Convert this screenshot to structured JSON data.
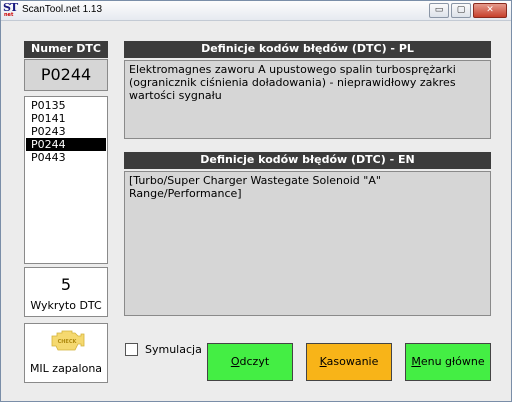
{
  "window": {
    "title": "ScanTool.net 1.13",
    "icon": {
      "letters_s": "S",
      "letters_t": "T",
      "sub": "net"
    },
    "controls": {
      "minimize": "▭",
      "maximize": "▢",
      "close": "✕"
    }
  },
  "dtc_panel": {
    "header": "Numer DTC",
    "current_code": "P0244",
    "codes": [
      "P0135",
      "P0141",
      "P0243",
      "P0244",
      "P0443"
    ],
    "selected_index": 3
  },
  "count_panel": {
    "number": "5",
    "label": "Wykryto DTC"
  },
  "mil_panel": {
    "icon": "check-engine-icon",
    "icon_text": "CHECK",
    "label": "MIL zapalona",
    "icon_color": "#f5d970"
  },
  "definitions": {
    "pl": {
      "header": "Definicje kodów błędów (DTC) - PL",
      "text": "Elektromagnes zaworu A upustowego spalin turbosprężarki (ogranicznik ciśnienia doładowania) - nieprawidłowy zakres wartości sygnału"
    },
    "en": {
      "header": "Definicje kodów błędów (DTC) - EN",
      "text": "[Turbo/Super Charger Wastegate Solenoid \"A\" Range/Performance]"
    }
  },
  "simulation": {
    "label": "Symulacja",
    "checked": false
  },
  "buttons": {
    "read": {
      "first": "O",
      "rest": "dczyt",
      "color": "#44ee44"
    },
    "clear": {
      "first": "K",
      "rest": "asowanie",
      "color": "#f8b418"
    },
    "menu": {
      "first": "M",
      "rest": "enu główne",
      "color": "#44ee44"
    }
  }
}
